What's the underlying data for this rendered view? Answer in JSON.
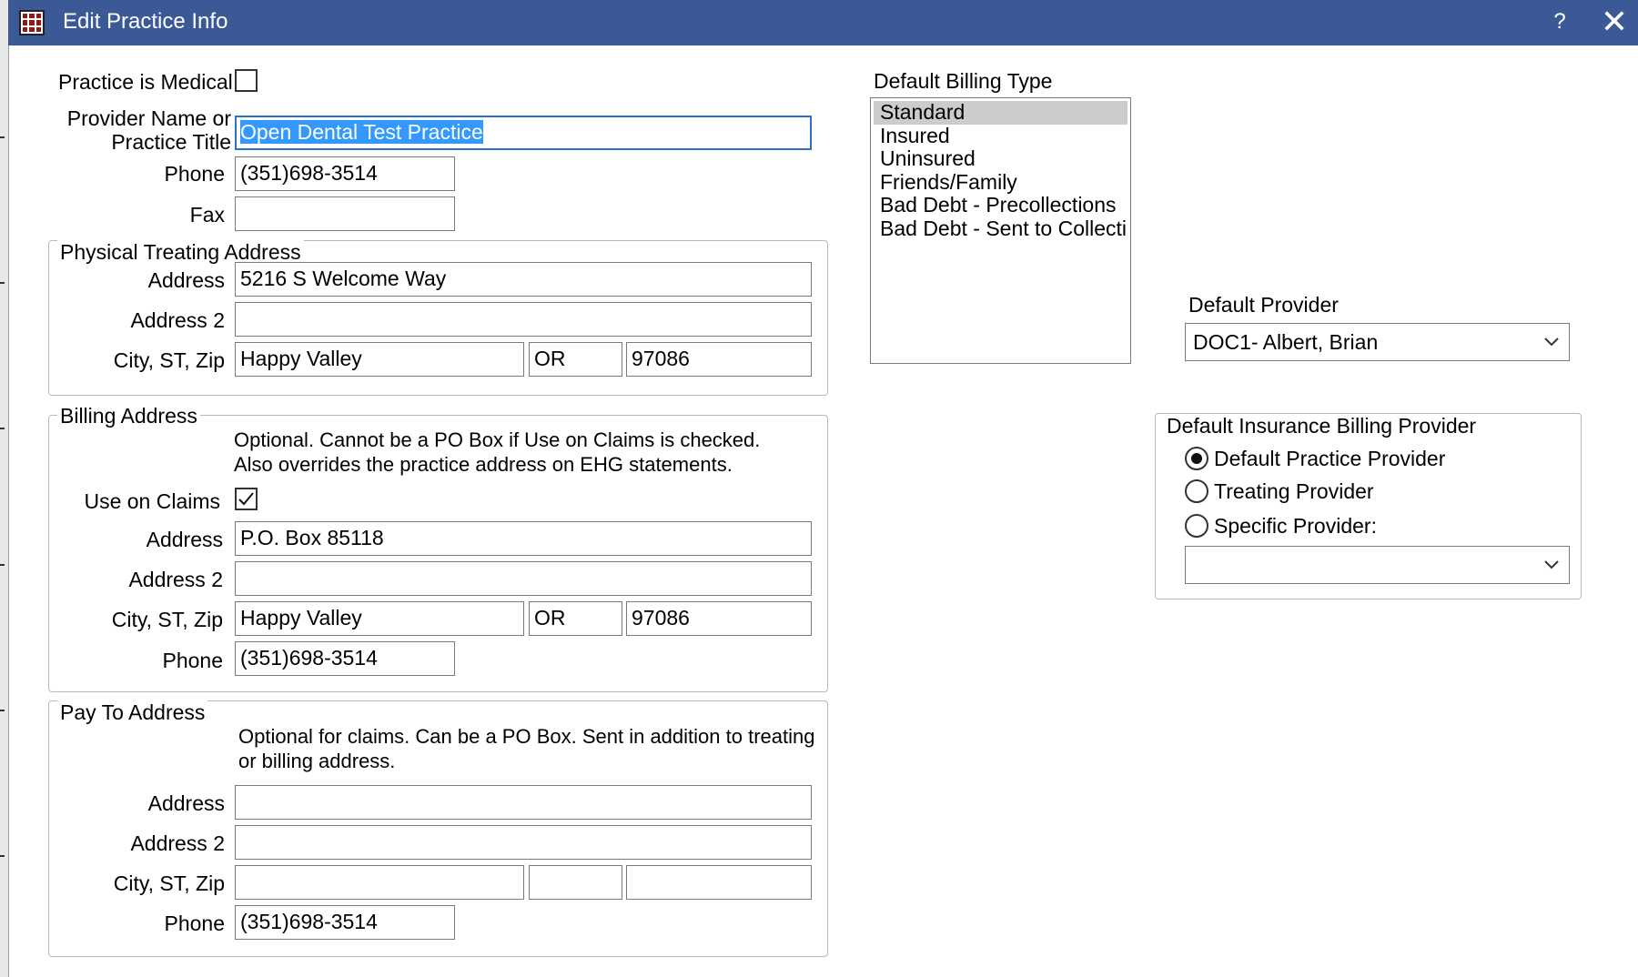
{
  "window": {
    "title": "Edit Practice Info",
    "help_label": "?",
    "close_label": "✕"
  },
  "practice": {
    "is_medical_label": "Practice is Medical",
    "is_medical_checked": false,
    "provider_name_label_1": "Provider Name or",
    "provider_name_label_2": "Practice Title",
    "provider_name_value": "Open Dental Test Practice",
    "phone_label": "Phone",
    "phone_value": "(351)698-3514",
    "fax_label": "Fax",
    "fax_value": ""
  },
  "physical_address": {
    "group_title": "Physical Treating Address",
    "address_label": "Address",
    "address_value": "5216 S Welcome Way",
    "address2_label": "Address 2",
    "address2_value": "",
    "city_st_zip_label": "City, ST, Zip",
    "city_value": "Happy Valley",
    "state_value": "OR",
    "zip_value": "97086"
  },
  "billing_address": {
    "group_title": "Billing Address",
    "note_line_1": "Optional.  Cannot be a PO Box if Use on Claims is checked.",
    "note_line_2": "Also overrides the practice address on EHG statements.",
    "use_on_claims_label": "Use on Claims",
    "use_on_claims_checked": true,
    "address_label": "Address",
    "address_value": "P.O. Box 85118",
    "address2_label": "Address 2",
    "address2_value": "",
    "city_st_zip_label": "City, ST, Zip",
    "city_value": "Happy Valley",
    "state_value": "OR",
    "zip_value": "97086",
    "phone_label": "Phone",
    "phone_value": "(351)698-3514"
  },
  "pay_to_address": {
    "group_title": "Pay To Address",
    "note_line_1": "Optional for claims.  Can be a PO Box.  Sent in addition to treating",
    "note_line_2": "or billing address.",
    "address_label": "Address",
    "address_value": "",
    "address2_label": "Address 2",
    "address2_value": "",
    "city_st_zip_label": "City, ST, Zip",
    "city_value": "",
    "state_value": "",
    "zip_value": "",
    "phone_label": "Phone",
    "phone_value": "(351)698-3514"
  },
  "default_billing_type": {
    "label": "Default Billing Type",
    "items": [
      {
        "label": "Standard",
        "selected": true
      },
      {
        "label": "Insured",
        "selected": false
      },
      {
        "label": "Uninsured",
        "selected": false
      },
      {
        "label": "Friends/Family",
        "selected": false
      },
      {
        "label": "Bad Debt - Precollections",
        "selected": false
      },
      {
        "label": "Bad Debt - Sent to Collecti",
        "selected": false
      }
    ]
  },
  "default_provider": {
    "label": "Default Provider",
    "selected_value": "DOC1- Albert, Brian"
  },
  "default_insurance_billing_provider": {
    "group_title": "Default Insurance Billing Provider",
    "options": [
      {
        "label": "Default Practice Provider",
        "selected": true
      },
      {
        "label": "Treating Provider",
        "selected": false
      },
      {
        "label": "Specific Provider:",
        "selected": false
      }
    ],
    "specific_provider_value": ""
  },
  "colors": {
    "titlebar_bg": "#3b5997",
    "focus_border": "#2672cc",
    "text_selection": "#3399ff",
    "list_selection": "#cccccc"
  }
}
